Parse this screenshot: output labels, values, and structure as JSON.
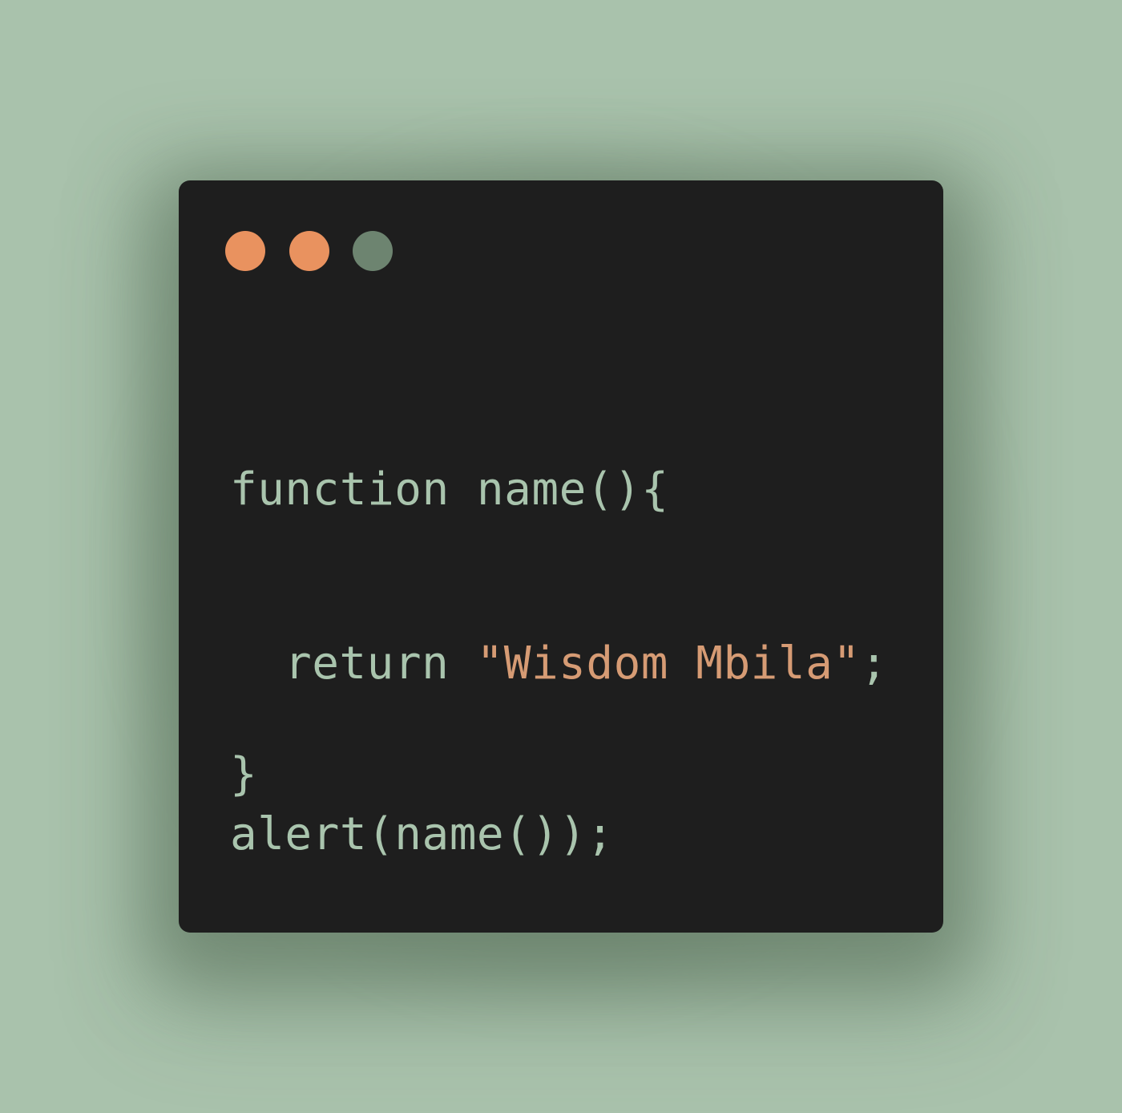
{
  "window": {
    "controls": [
      {
        "name": "close",
        "color": "#e9925f"
      },
      {
        "name": "minimize",
        "color": "#e9925f"
      },
      {
        "name": "maximize",
        "color": "#6d8470"
      }
    ]
  },
  "colors": {
    "background": "#a9c2ac",
    "editor": "#1e1e1e",
    "code_text": "#a9c4ad",
    "string": "#d69b74"
  },
  "code": {
    "line1": "function name(){",
    "line2_keyword": "return",
    "line2_string": "\"Wisdom Mbila\"",
    "line2_end": ";",
    "line3": "}",
    "line4": "alert(name());"
  }
}
